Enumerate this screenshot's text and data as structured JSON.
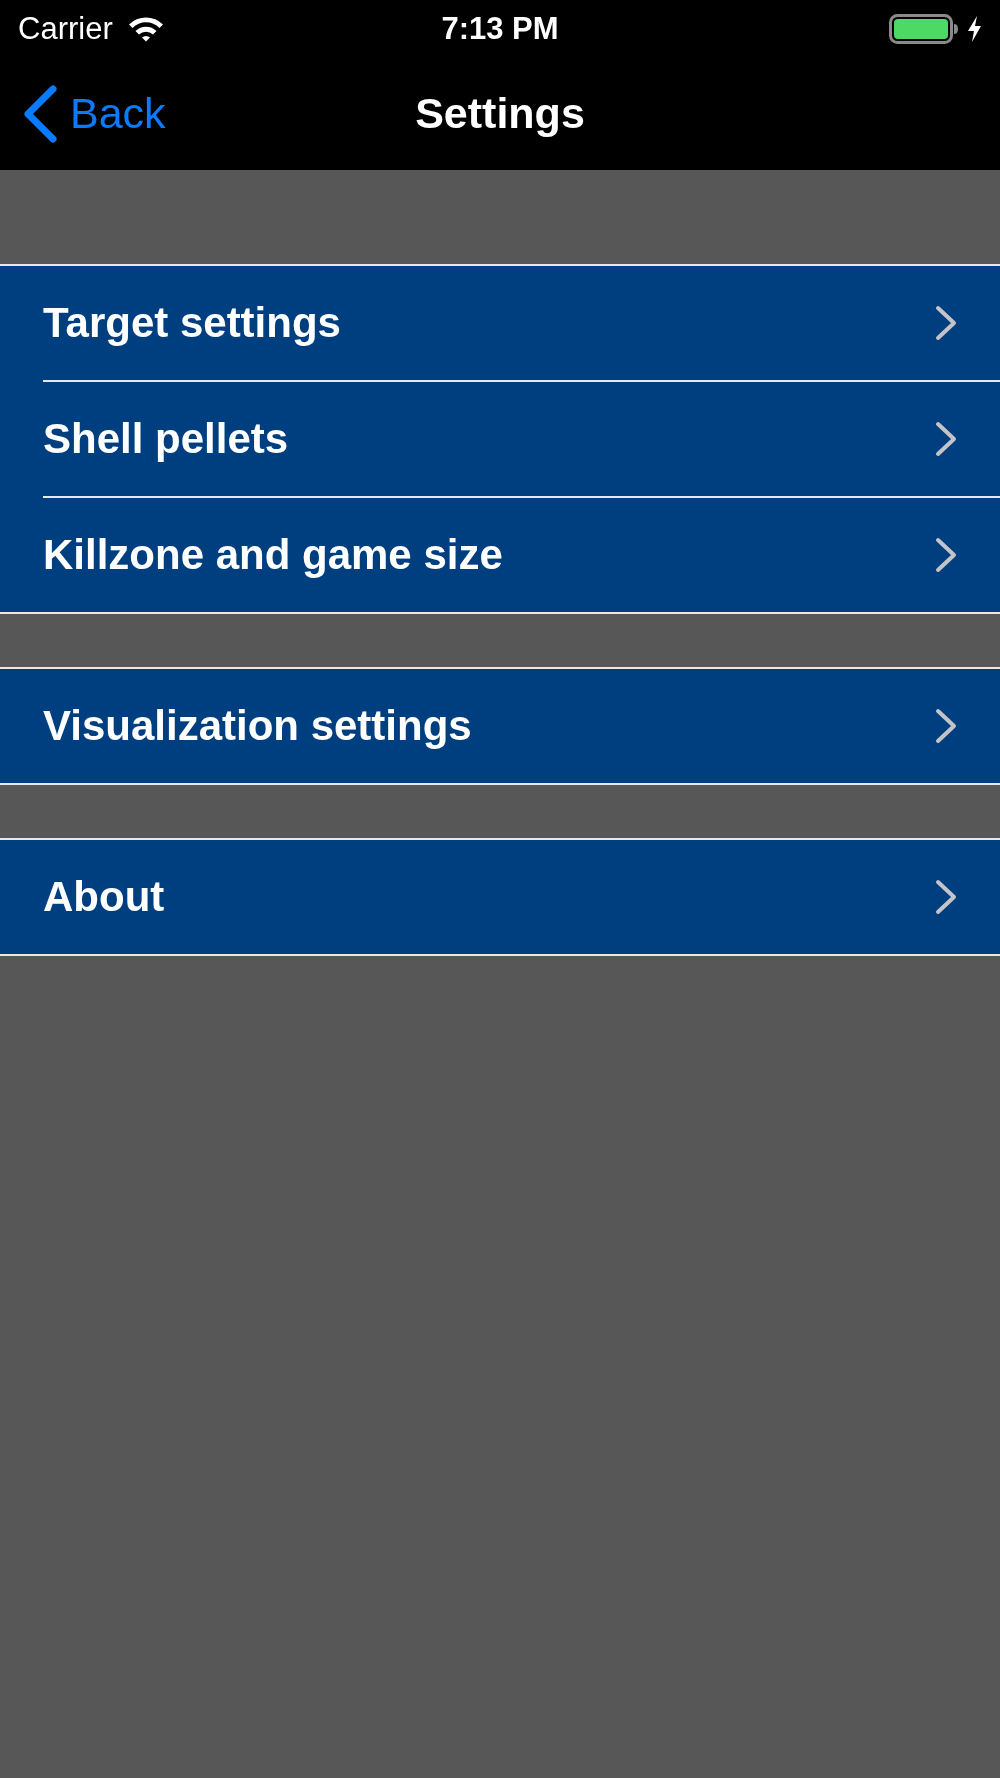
{
  "status_bar": {
    "carrier": "Carrier",
    "time": "7:13 PM"
  },
  "nav_bar": {
    "back_label": "Back",
    "title": "Settings"
  },
  "sections": [
    {
      "items": [
        {
          "label": "Target settings"
        },
        {
          "label": "Shell pellets"
        },
        {
          "label": "Killzone and game size"
        }
      ]
    },
    {
      "items": [
        {
          "label": "Visualization settings"
        }
      ]
    },
    {
      "items": [
        {
          "label": "About"
        }
      ]
    }
  ]
}
